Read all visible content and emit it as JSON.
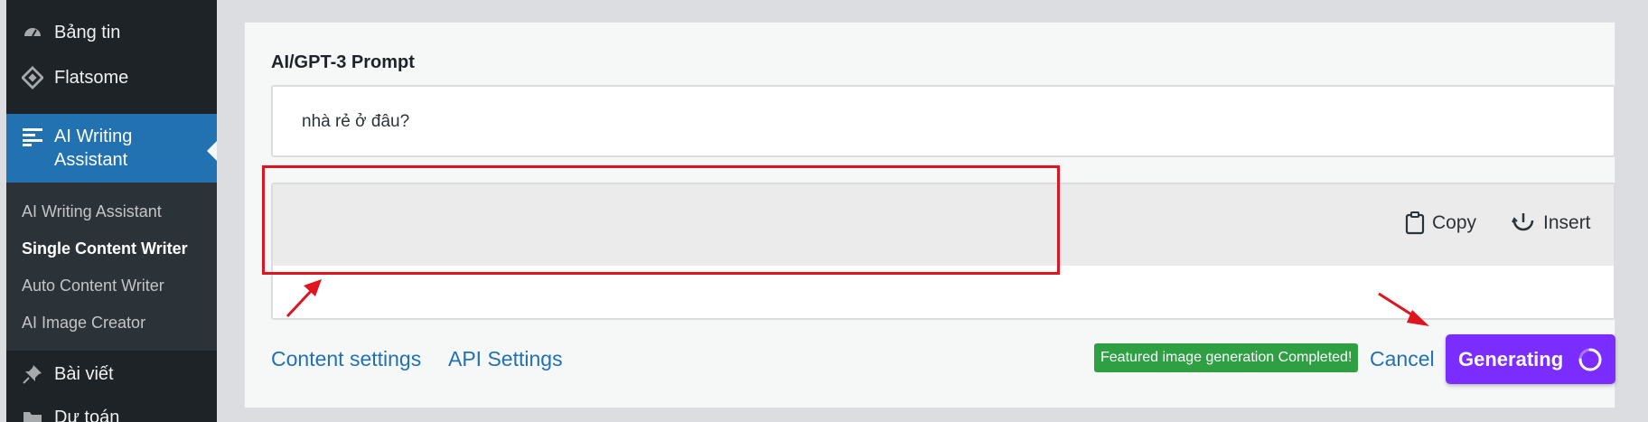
{
  "sidebar": {
    "items": [
      {
        "label": "Bảng tin",
        "icon": "dashboard-icon"
      },
      {
        "label": "Flatsome",
        "icon": "flatsome-icon"
      },
      {
        "label": "AI Writing Assistant",
        "icon": "align-left-icon"
      },
      {
        "label": "Bài viết",
        "icon": "pin-icon"
      },
      {
        "label": "Dự toán",
        "icon": "folder-icon"
      }
    ],
    "submenu": [
      {
        "label": "AI Writing Assistant"
      },
      {
        "label": "Single Content Writer",
        "current": true
      },
      {
        "label": "Auto Content Writer"
      },
      {
        "label": "AI Image Creator"
      }
    ],
    "ai_line1": "AI Writing",
    "ai_line2": "Assistant"
  },
  "main": {
    "prompt_label": "AI/GPT-3 Prompt",
    "prompt_value": "nhà rẻ ở đâu?",
    "toolbar": {
      "copy_label": "Copy",
      "insert_label": "Insert"
    },
    "footer": {
      "content_settings": "Content settings",
      "api_settings": "API Settings",
      "status_badge": "Featured image generation Completed!",
      "cancel": "Cancel",
      "generating": "Generating"
    }
  },
  "colors": {
    "accent_blue": "#2271b1",
    "generate_purple": "#7b2cff",
    "success_green": "#2ea043",
    "annotation_red": "#e0141e"
  }
}
